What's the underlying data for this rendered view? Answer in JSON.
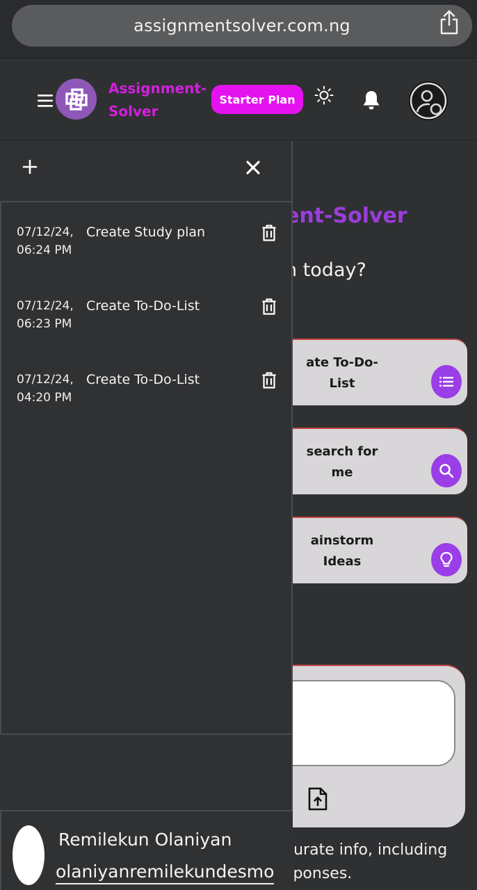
{
  "browser": {
    "url": "assignmentsolver.com.ng"
  },
  "header": {
    "brand": "Assignment-Solver",
    "brand_line1": "Assignment-",
    "brand_line2": "Solver",
    "plan_label": "Starter Plan"
  },
  "main": {
    "welcome_visible": "ent-Solver",
    "question_visible": "n today?",
    "cards": [
      {
        "line1": "ate To-Do-",
        "line2": "List",
        "icon": "list-icon"
      },
      {
        "line1": "search for",
        "line2": "me",
        "icon": "search-icon"
      },
      {
        "line1": "ainstorm",
        "line2": "Ideas",
        "icon": "lightbulb-icon"
      }
    ],
    "disclaimer_line1": "curate info, including",
    "disclaimer_line2": "sponses."
  },
  "drawer": {
    "history": [
      {
        "date_line1": "07/12/24,",
        "date_line2": "06:24 PM",
        "title": "Create Study plan"
      },
      {
        "date_line1": "07/12/24,",
        "date_line2": "06:23 PM",
        "title": "Create To-Do-List"
      },
      {
        "date_line1": "07/12/24,",
        "date_line2": "04:20 PM",
        "title": "Create To-Do-List"
      }
    ],
    "user": {
      "name": "Remilekun Olaniyan",
      "email": "olaniyanremilekundesmo"
    }
  },
  "colors": {
    "brand": "#d41fe0",
    "plan_button": "#e312ef",
    "accent_purple": "#9a3ee8",
    "background": "#2f3032"
  }
}
